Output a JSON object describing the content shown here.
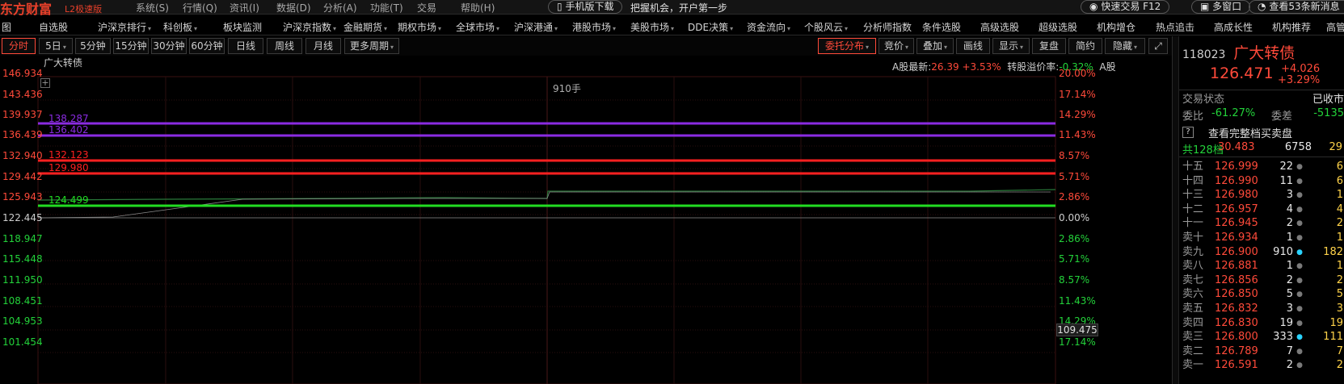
{
  "titlebar": {
    "brand": "东方财富",
    "edition": "L2极速版",
    "menus": [
      "系统(S)",
      "行情(Q)",
      "资讯(I)",
      "数据(D)",
      "分析(A)",
      "功能(T)",
      "交易",
      "帮助(H)"
    ],
    "mobile_download": "手机版下载",
    "slogan": "把握机会，开户第一步",
    "quick_trade": "快速交易 F12",
    "multi_window": "多窗口",
    "messages": "查看53条新消息"
  },
  "nav": {
    "items": [
      "图",
      "自选股",
      "沪深京排行",
      "科创板",
      "板块监测",
      "沪深京指数",
      "金融期货",
      "期权市场",
      "全球市场",
      "沪深港通",
      "港股市场",
      "美股市场",
      "DDE决策",
      "资金流向",
      "个股风云",
      "分析师指数",
      "条件选股",
      "高级选股",
      "超级选股",
      "机构增仓",
      "热点追击",
      "高成长性",
      "机构推荐",
      "高管"
    ]
  },
  "periods": {
    "left": [
      "分时",
      "5日",
      "5分钟",
      "15分钟",
      "30分钟",
      "60分钟",
      "日线",
      "周线",
      "月线",
      "更多周期"
    ],
    "right": [
      "委托分布",
      "竞价",
      "叠加",
      "画线",
      "显示",
      "复盘",
      "简约",
      "隐藏"
    ]
  },
  "chart": {
    "title": "广大转债",
    "info_label_price": "A股最新:",
    "info_price": "26.39",
    "info_change": "+3.53%",
    "info_label_premium": "转股溢价率:",
    "info_premium": "-0.32%",
    "info_stock": "A股",
    "volume_label": "910手",
    "cursor_price": "109.475",
    "y_left": [
      "146.934",
      "143.436",
      "139.937",
      "136.439",
      "132.940",
      "129.442",
      "125.943",
      "122.445",
      "118.947",
      "115.448",
      "111.950",
      "108.451",
      "104.953",
      "101.454"
    ],
    "y_right": [
      "20.00%",
      "17.14%",
      "14.29%",
      "11.43%",
      "8.57%",
      "5.71%",
      "2.86%",
      "0.00%",
      "2.86%",
      "5.71%",
      "8.57%",
      "11.43%",
      "14.29%",
      "17.14%"
    ],
    "levels": [
      {
        "value": "138.287",
        "color": "#8a2be2"
      },
      {
        "value": "136.402",
        "color": "#8a2be2"
      },
      {
        "value": "132.123",
        "color": "#ff2020"
      },
      {
        "value": "129.980",
        "color": "#ff2020"
      },
      {
        "value": "124.499",
        "color": "#22dd22"
      }
    ]
  },
  "panel": {
    "code": "118023",
    "name": "广大转债",
    "price": "126.471",
    "change": "+4.026",
    "change_pct": "+3.29%",
    "status_label": "交易状态",
    "status_value": "已收市",
    "ratio_label": "委比",
    "ratio_value": "-61.27%",
    "diff_label": "委差",
    "diff_value": "-5135",
    "help_icon": "?",
    "full_book": "查看完整档买卖盘",
    "total_levels": "共128档",
    "total_price": "30.483",
    "total_qty": "6758",
    "total_q2": "29",
    "orderbook": [
      {
        "level": "十五",
        "price": "126.999",
        "qty": "22",
        "dot": "gray",
        "q2": "6"
      },
      {
        "level": "十四",
        "price": "126.990",
        "qty": "11",
        "dot": "gray",
        "q2": "6"
      },
      {
        "level": "十三",
        "price": "126.980",
        "qty": "3",
        "dot": "gray",
        "q2": "1"
      },
      {
        "level": "十二",
        "price": "126.957",
        "qty": "4",
        "dot": "gray",
        "q2": "4"
      },
      {
        "level": "十一",
        "price": "126.945",
        "qty": "2",
        "dot": "gray",
        "q2": "2"
      },
      {
        "level": "卖十",
        "price": "126.934",
        "qty": "1",
        "dot": "gray",
        "q2": "1"
      },
      {
        "level": "卖九",
        "price": "126.900",
        "qty": "910",
        "dot": "cyan",
        "q2": "182"
      },
      {
        "level": "卖八",
        "price": "126.881",
        "qty": "1",
        "dot": "gray",
        "q2": "1"
      },
      {
        "level": "卖七",
        "price": "126.856",
        "qty": "2",
        "dot": "gray",
        "q2": "2"
      },
      {
        "level": "卖六",
        "price": "126.850",
        "qty": "5",
        "dot": "gray",
        "q2": "5"
      },
      {
        "level": "卖五",
        "price": "126.832",
        "qty": "3",
        "dot": "gray",
        "q2": "3"
      },
      {
        "level": "卖四",
        "price": "126.830",
        "qty": "19",
        "dot": "gray",
        "q2": "19"
      },
      {
        "level": "卖三",
        "price": "126.800",
        "qty": "333",
        "dot": "cyan",
        "q2": "111"
      },
      {
        "level": "卖二",
        "price": "126.789",
        "qty": "7",
        "dot": "gray",
        "q2": "7"
      },
      {
        "level": "卖一",
        "price": "126.591",
        "qty": "2",
        "dot": "gray",
        "q2": "2"
      }
    ]
  }
}
